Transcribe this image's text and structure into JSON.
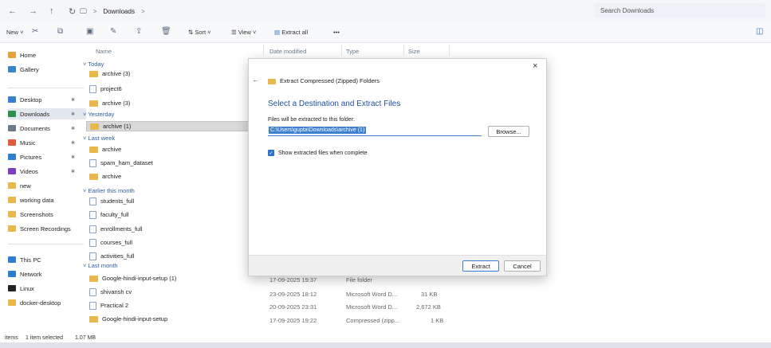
{
  "address": {
    "back_glyph": "←",
    "forward_glyph": "→",
    "up_glyph": "↑",
    "refresh_glyph": "↻",
    "monitor_glyph": "🖵",
    "sep": ">",
    "folder": "Downloads",
    "sep2": ">",
    "search_placeholder": "Search Downloads"
  },
  "toolbar": {
    "new": "New",
    "sort": "Sort",
    "view": "View",
    "extract_all": "Extract all",
    "more": "•••"
  },
  "sidebar": {
    "items": [
      {
        "label": "Home",
        "icon": "home-icon",
        "color": "#e8a23a"
      },
      {
        "label": "Gallery",
        "icon": "gallery-icon",
        "color": "#3a86c8"
      },
      {
        "label": "Desktop",
        "icon": "desktop-icon",
        "color": "#3a7fd0",
        "pinned": true
      },
      {
        "label": "Downloads",
        "icon": "download-icon",
        "color": "#2f8f4f",
        "pinned": true
      },
      {
        "label": "Documents",
        "icon": "documents-icon",
        "color": "#6d7a88",
        "pinned": true
      },
      {
        "label": "Music",
        "icon": "music-icon",
        "color": "#e35b3b",
        "pinned": true
      },
      {
        "label": "Pictures",
        "icon": "pictures-icon",
        "color": "#2f7fd0",
        "pinned": true
      },
      {
        "label": "Videos",
        "icon": "videos-icon",
        "color": "#7b3fc4",
        "pinned": true
      },
      {
        "label": "new",
        "icon": "folder-icon",
        "color": "#e8b84a"
      },
      {
        "label": "working data",
        "icon": "folder-icon",
        "color": "#e8b84a"
      },
      {
        "label": "Screenshots",
        "icon": "folder-icon",
        "color": "#e8b84a"
      },
      {
        "label": "Screen Recordings",
        "icon": "folder-icon",
        "color": "#e8b84a"
      },
      {
        "label": "This PC",
        "icon": "pc-icon",
        "color": "#2f7fd0"
      },
      {
        "label": "Network",
        "icon": "network-icon",
        "color": "#2f7fd0"
      },
      {
        "label": "Linux",
        "icon": "linux-icon",
        "color": "#222222"
      },
      {
        "label": "docker-desktop",
        "icon": "folder-icon",
        "color": "#e8b84a"
      }
    ]
  },
  "list": {
    "headers": {
      "name": "Name",
      "date": "Date modified",
      "type": "Type",
      "size": "Size"
    },
    "groups": {
      "today": "Today",
      "yesterday": "Yesterday",
      "last_week": "Last week",
      "earlier": "Earlier this month",
      "last_month": "Last month"
    },
    "files": [
      "archive (3)",
      "project6",
      "archive (3)",
      "archive (1)",
      "archive",
      "spam_ham_dataset",
      "archive",
      "students_full",
      "faculty_full",
      "enrollments_full",
      "courses_full",
      "activities_full",
      "Google-hindi-input-setup (1)",
      "shivansh cv",
      "Practical 2",
      "Google-hindi-input-setup"
    ],
    "details": [
      {
        "date": "17-09-2025 19:37",
        "type": "File folder",
        "size": ""
      },
      {
        "date": "23-09-2025 18:12",
        "type": "Microsoft Word D...",
        "size": "31 KB"
      },
      {
        "date": "20-09-2025 23:31",
        "type": "Microsoft Word D...",
        "size": "2,672 KB"
      },
      {
        "date": "17-09-2025 19:22",
        "type": "Compressed (zipp...",
        "size": "1 KB"
      }
    ]
  },
  "dialog": {
    "back_glyph": "←",
    "close_glyph": "×",
    "title": "Extract Compressed (Zipped) Folders",
    "heading": "Select a Destination and Extract Files",
    "field_label": "Files will be extracted to this folder:",
    "path": "C:\\Users\\gupta\\Downloads\\archive (1)",
    "browse": "Browse...",
    "checkbox_label": "Show extracted files when complete",
    "extract": "Extract",
    "cancel": "Cancel"
  },
  "status": {
    "items": "items",
    "selected": "1 item selected",
    "size": "1.07 MB"
  },
  "colors": {
    "accent": "#2f6fc8",
    "heading": "#1f4ea0",
    "selection": "#3f7fd0"
  }
}
